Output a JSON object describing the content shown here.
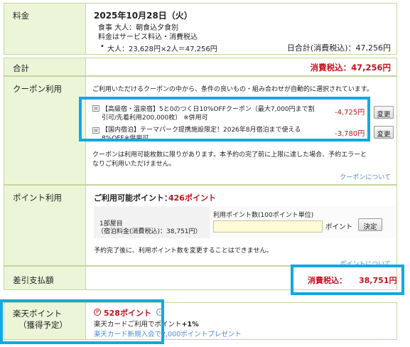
{
  "fee": {
    "label": "料金",
    "date": "2025年10月28日（火）",
    "meal": "食事  大人：朝食込夕食別",
    "tax_note": "料金はサービス料込・消費税込",
    "breakdown_bullet": "•",
    "breakdown": "大人：23,628円×2人＝47,256円",
    "daily_total": "日合計(消費税込)：47,256円"
  },
  "total": {
    "label": "合計",
    "value": "消費税込：47,256円"
  },
  "coupon": {
    "label": "クーポン利用",
    "intro": "ご利用いただけるクーポンの中から、条件の良いもの・組み合わせが自動的に選択されています。",
    "items": [
      {
        "line1": "【高級宿・温泉宿】5と0のつく日10%OFFクーポン（最大7,000円まで割",
        "line2": "引可/先着利用200,000枚）   ※併用可",
        "amount": "-4,725円",
        "button": "変更"
      },
      {
        "line1": "【国内宿泊】テーマパーク提携施設限定！2026年8月宿泊まで使える",
        "line2": "8%OFF※併用可",
        "amount": "-3,780円",
        "button": "変更"
      }
    ],
    "note_line1": "クーポンは利用可能枚数に限りがあります。本予約の完了前に上限に達した場合、予約エラーと",
    "note_line2": "なりご利用いただけません。",
    "about_link": "クーポンについて"
  },
  "points": {
    "label": "ポイント利用",
    "available_label": "ご利用可能ポイント：",
    "available_value": "426ポイント",
    "room_label": "1部屋目",
    "room_fee": "（宿泊料金(消費税込)：38,751円）",
    "input_label": "利用ポイント数(100ポイント単位)",
    "input_value": "",
    "unit": "ポイント",
    "confirm_button": "決定",
    "note": "予約完了後に、利用ポイント数を変更することはできません。",
    "about_link": "ポイントについて"
  },
  "payment": {
    "label": "差引支払額",
    "tax_label": "消費税込：",
    "value": "38,751円"
  },
  "rakuten": {
    "label_line1": "楽天ポイント",
    "label_line2": "（獲得予定）",
    "points": "528ポイント",
    "card_text": "楽天カードご利用でポイント",
    "card_bonus": "+1%",
    "promo_link": "楽天カード新規入会で2,000ポイントプレゼント"
  },
  "colors": {
    "label_bg": "#edf5d9",
    "border": "#c3d79a",
    "accent_red": "#c1121f",
    "highlight": "#13a8df",
    "link": "#4a8bd6"
  }
}
